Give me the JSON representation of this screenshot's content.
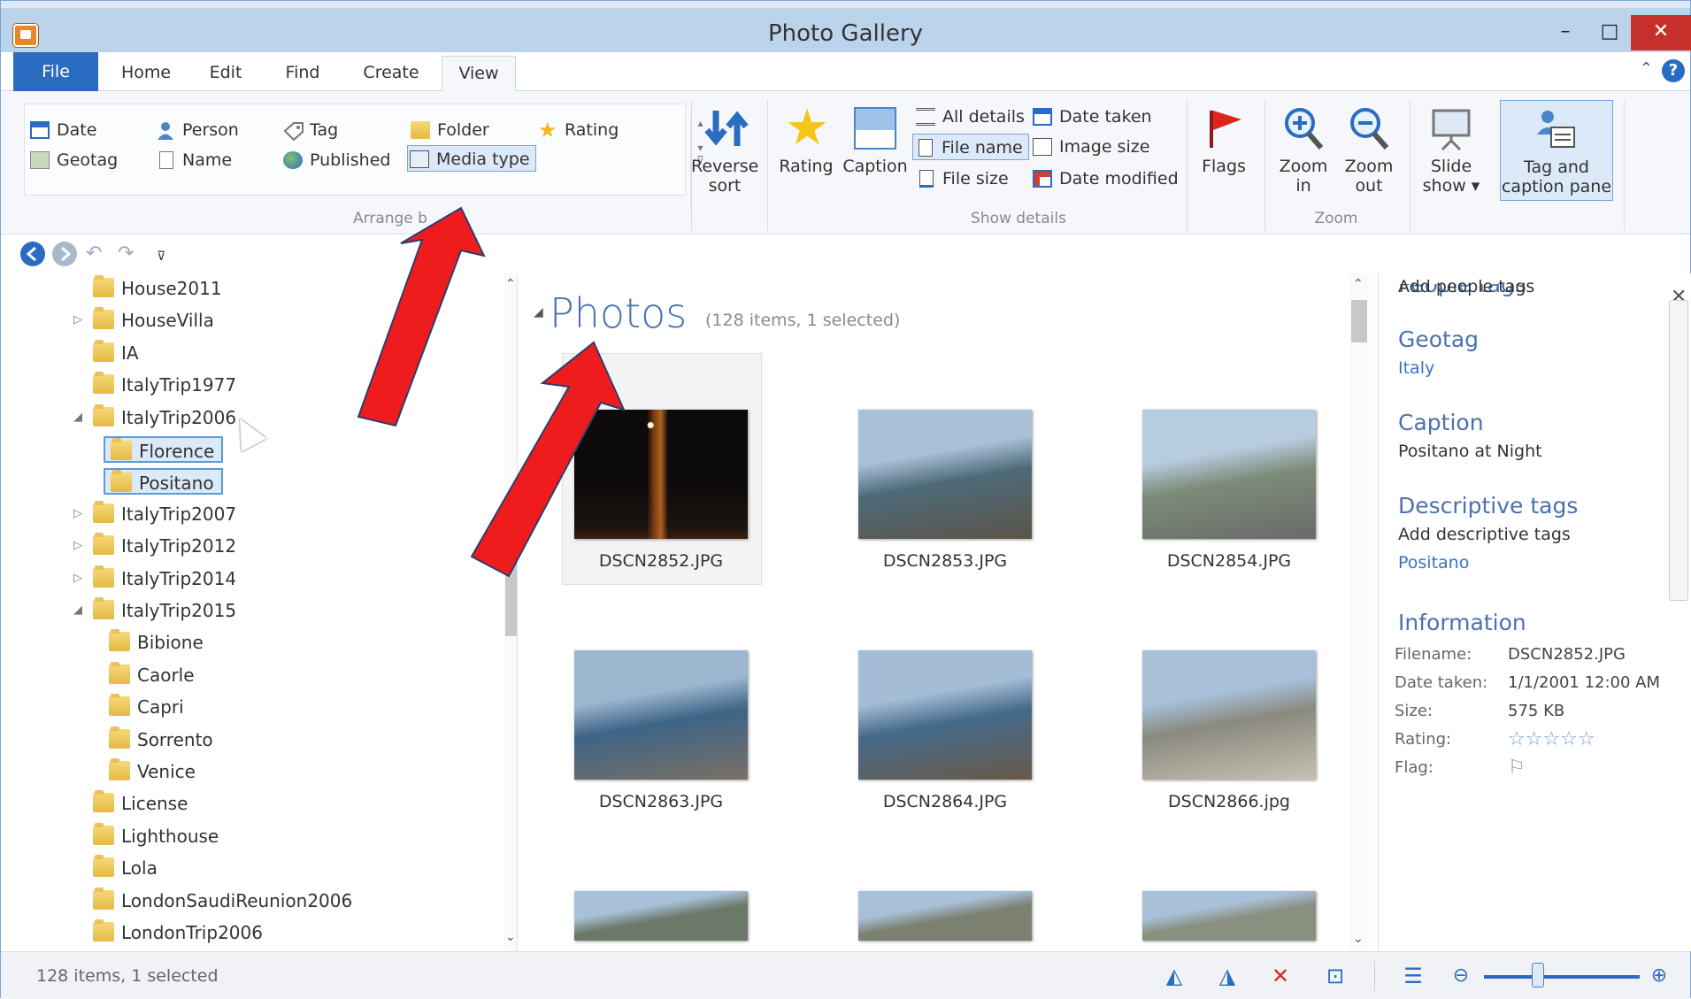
{
  "window": {
    "title": "Photo Gallery",
    "min": "–",
    "max": "□",
    "close": "✕"
  },
  "tabs": [
    "File",
    "Home",
    "Edit",
    "Find",
    "Create",
    "View"
  ],
  "ribbon": {
    "arrange": {
      "items": [
        "Date",
        "Person",
        "Tag",
        "Folder",
        "Rating",
        "Geotag",
        "Name",
        "Published",
        "Media type"
      ],
      "label": "Arrange by",
      "label_visible": "Arrange b"
    },
    "reverse_sort": [
      "Reverse",
      "sort"
    ],
    "show_details": {
      "rating": "Rating",
      "caption": "Caption",
      "all_details": "All details",
      "file_name": "File name",
      "file_size": "File size",
      "date_taken": "Date taken",
      "image_size": "Image size",
      "date_modified": "Date modified",
      "label": "Show details"
    },
    "flags": "Flags",
    "zoom": {
      "in": [
        "Zoom",
        "in"
      ],
      "out": [
        "Zoom",
        "out"
      ],
      "label": "Zoom"
    },
    "slide_show": [
      "Slide",
      "show ▾"
    ],
    "tag_caption": [
      "Tag and",
      "caption pane"
    ]
  },
  "tree": [
    {
      "label": "House2011",
      "indent": 0
    },
    {
      "label": "HouseVilla",
      "indent": 0,
      "exp": "▷"
    },
    {
      "label": "IA",
      "indent": 0
    },
    {
      "label": "ItalyTrip1977",
      "indent": 0
    },
    {
      "label": "ItalyTrip2006",
      "indent": 0,
      "exp": "◢"
    },
    {
      "label": "Florence",
      "indent": 1,
      "selected": true
    },
    {
      "label": "Positano",
      "indent": 1,
      "selected": true
    },
    {
      "label": "ItalyTrip2007",
      "indent": 0,
      "exp": "▷"
    },
    {
      "label": "ItalyTrip2012",
      "indent": 0,
      "exp": "▷"
    },
    {
      "label": "ItalyTrip2014",
      "indent": 0,
      "exp": "▷"
    },
    {
      "label": "ItalyTrip2015",
      "indent": 0,
      "exp": "◢"
    },
    {
      "label": "Bibione",
      "indent": 1
    },
    {
      "label": "Caorle",
      "indent": 1
    },
    {
      "label": "Capri",
      "indent": 1
    },
    {
      "label": "Sorrento",
      "indent": 1
    },
    {
      "label": "Venice",
      "indent": 1
    },
    {
      "label": "License",
      "indent": 0
    },
    {
      "label": "Lighthouse",
      "indent": 0
    },
    {
      "label": "Lola",
      "indent": 0
    },
    {
      "label": "LondonSaudiReunion2006",
      "indent": 0
    },
    {
      "label": "LondonTrip2006",
      "indent": 0
    }
  ],
  "main": {
    "title": "Photos",
    "count": "(128 items, 1 selected)",
    "photos": [
      {
        "name": "DSCN2852.JPG",
        "colors": [
          "#0d0b0a",
          "#1a1410",
          "#3a2010"
        ]
      },
      {
        "name": "DSCN2853.JPG",
        "colors": [
          "#a9c0d8",
          "#4e6a78",
          "#5c5448"
        ]
      },
      {
        "name": "DSCN2854.JPG",
        "colors": [
          "#b8cce0",
          "#7c8c78",
          "#6a6a6a"
        ]
      },
      {
        "name": "DSCN2863.JPG",
        "colors": [
          "#9cb6d0",
          "#3e6486",
          "#7a7064"
        ]
      },
      {
        "name": "DSCN2864.JPG",
        "colors": [
          "#a4bcd6",
          "#456a8a",
          "#6a5a48"
        ]
      },
      {
        "name": "DSCN2866.jpg",
        "colors": [
          "#a8c0da",
          "#8a8a7e",
          "#c8c0b4"
        ]
      },
      {
        "name": "",
        "colors": [
          "#a8c0d8",
          "#6c7868",
          "#6c7868"
        ]
      },
      {
        "name": "",
        "colors": [
          "#a8c0d8",
          "#7c8070",
          "#7c8070"
        ]
      },
      {
        "name": "",
        "colors": [
          "#a8c0d8",
          "#8a9080",
          "#8a9080"
        ]
      }
    ]
  },
  "pane": {
    "people_tags_heading": "People tags",
    "add_people": "Add people tags",
    "geotag_heading": "Geotag",
    "geotag_value": "Italy",
    "caption_heading": "Caption",
    "caption_value": "Positano at Night",
    "desc_heading": "Descriptive tags",
    "add_desc": "Add descriptive tags",
    "desc_value": "Positano",
    "info_heading": "Information",
    "info": [
      {
        "label": "Filename:",
        "value": "DSCN2852.JPG"
      },
      {
        "label": "Date taken:",
        "value": "1/1/2001   12:00 AM"
      },
      {
        "label": "Size:",
        "value": "575 KB"
      },
      {
        "label": "Rating:",
        "value": "☆☆☆☆☆"
      },
      {
        "label": "Flag:",
        "value": "⚐"
      }
    ]
  },
  "status": {
    "text": "128 items, 1 selected"
  },
  "colors": {
    "accent": "#2a6cc1",
    "arrow": "#ee1c1c"
  }
}
